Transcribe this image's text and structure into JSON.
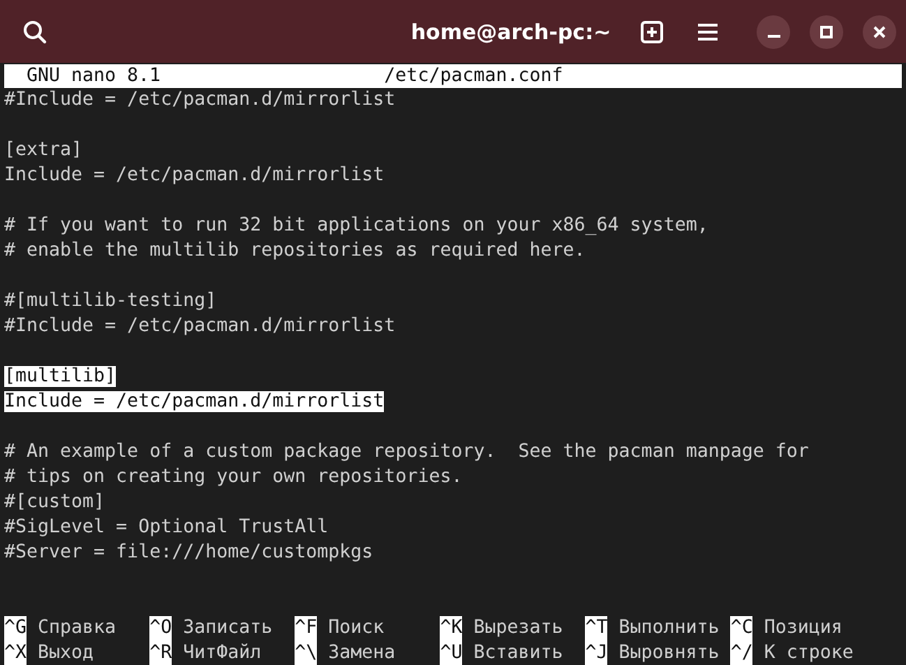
{
  "window": {
    "title": "home@arch-pc:~"
  },
  "editor": {
    "app": "GNU nano 8.1",
    "file": "/etc/pacman.conf",
    "lines": [
      {
        "kind": "text",
        "text": "#Include = /etc/pacman.d/mirrorlist",
        "highlighted": false
      },
      {
        "kind": "blank"
      },
      {
        "kind": "text",
        "text": "[extra]",
        "highlighted": false
      },
      {
        "kind": "text",
        "text": "Include = /etc/pacman.d/mirrorlist",
        "highlighted": false
      },
      {
        "kind": "blank"
      },
      {
        "kind": "text",
        "text": "# If you want to run 32 bit applications on your x86_64 system,",
        "highlighted": false
      },
      {
        "kind": "text",
        "text": "# enable the multilib repositories as required here.",
        "highlighted": false
      },
      {
        "kind": "blank"
      },
      {
        "kind": "text",
        "text": "#[multilib-testing]",
        "highlighted": false
      },
      {
        "kind": "text",
        "text": "#Include = /etc/pacman.d/mirrorlist",
        "highlighted": false
      },
      {
        "kind": "blank"
      },
      {
        "kind": "text",
        "text": "[multilib]",
        "highlighted": true
      },
      {
        "kind": "text",
        "text": "Include = /etc/pacman.d/mirrorlist",
        "highlighted": true
      },
      {
        "kind": "blank"
      },
      {
        "kind": "text",
        "text": "# An example of a custom package repository.  See the pacman manpage for",
        "highlighted": false
      },
      {
        "kind": "text",
        "text": "# tips on creating your own repositories.",
        "highlighted": false
      },
      {
        "kind": "text",
        "text": "#[custom]",
        "highlighted": false
      },
      {
        "kind": "text",
        "text": "#SigLevel = Optional TrustAll",
        "highlighted": false
      },
      {
        "kind": "text",
        "text": "#Server = file:///home/custompkgs",
        "highlighted": false
      },
      {
        "kind": "blank"
      },
      {
        "kind": "blank"
      }
    ]
  },
  "shortcuts": [
    [
      {
        "key": "^G",
        "label": "Справка"
      },
      {
        "key": "^O",
        "label": "Записать"
      },
      {
        "key": "^F",
        "label": "Поиск"
      },
      {
        "key": "^K",
        "label": "Вырезать"
      },
      {
        "key": "^T",
        "label": "Выполнить"
      },
      {
        "key": "^C",
        "label": "Позиция"
      }
    ],
    [
      {
        "key": "^X",
        "label": "Выход"
      },
      {
        "key": "^R",
        "label": "ЧитФайл"
      },
      {
        "key": "^\\",
        "label": "Замена"
      },
      {
        "key": "^U",
        "label": "Вставить"
      },
      {
        "key": "^J",
        "label": "Выровнять"
      },
      {
        "key": "^/",
        "label": "К строке"
      }
    ]
  ]
}
